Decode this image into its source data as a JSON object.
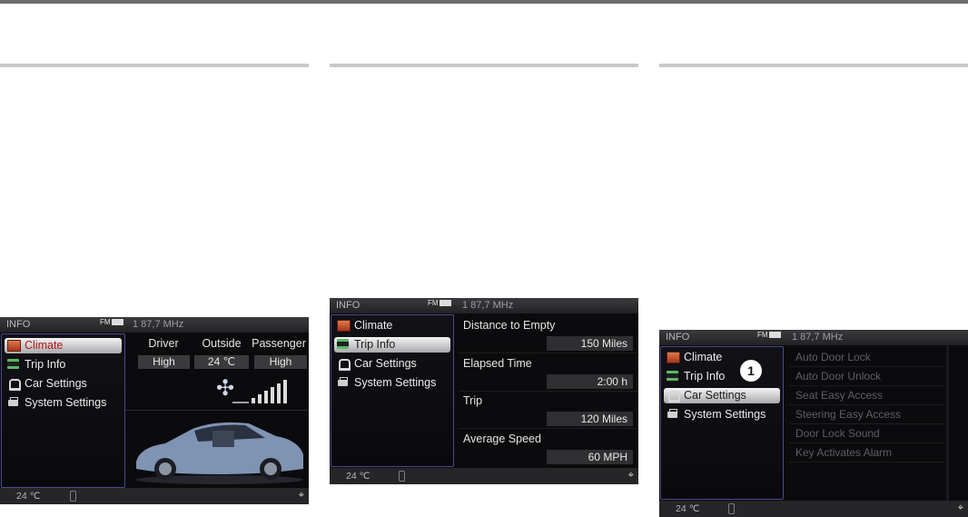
{
  "header": {
    "info_label": "INFO",
    "fm_label": "FM",
    "radio": "1   87,7 MHz"
  },
  "menu": {
    "climate": "Climate",
    "trip_info": "Trip Info",
    "car_settings": "Car Settings",
    "system_settings": "System Settings"
  },
  "footer": {
    "temperature": "24 ℃",
    "location_glyph": "⌖"
  },
  "climate_panel": {
    "selected_menu": "Climate",
    "columns": [
      {
        "heading": "Driver",
        "value": "High"
      },
      {
        "heading": "Outside",
        "value": "24 ℃"
      },
      {
        "heading": "Passenger",
        "value": "High"
      }
    ],
    "fan_glyph": "✣",
    "fan_level_bars": 6
  },
  "trip_panel": {
    "selected_menu": "Trip Info",
    "rows": [
      {
        "label": "Distance to Empty",
        "value": "150 Miles"
      },
      {
        "label": "Elapsed Time",
        "value": "2:00 h"
      },
      {
        "label": "Trip",
        "value": "120 Miles"
      },
      {
        "label": "Average Speed",
        "value": "60 MPH"
      }
    ]
  },
  "settings_panel": {
    "selected_menu": "Car Settings",
    "callout": "1",
    "items": [
      "Auto Door Lock",
      "Auto Door Unlock",
      "Seat Easy Access",
      "Steering Easy Access",
      "Door Lock Sound",
      "Key Activates Alarm"
    ]
  },
  "colors": {
    "accent_border": "#4a4a8e",
    "selected_red_text": "#b11717"
  }
}
